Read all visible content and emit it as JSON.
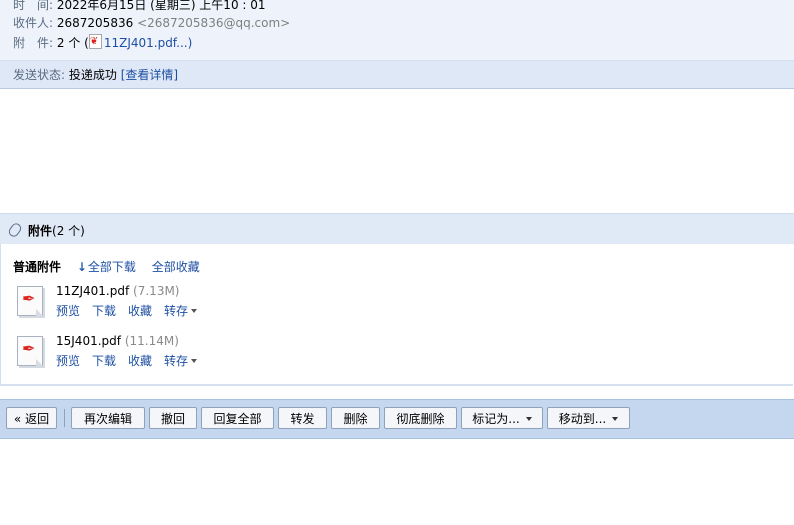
{
  "header": {
    "time": {
      "label": "时　间:",
      "value": "2022年6月15日 (星期三) 上午10 : 01"
    },
    "recipient": {
      "label": "收件人:",
      "name": "2687205836",
      "email": "<2687205836@qq.com>"
    },
    "attachments": {
      "label": "附　件:",
      "count": "2 个 (",
      "file_link": "11ZJ401.pdf...",
      "close_paren": ")"
    },
    "status": {
      "label": "发送状态:",
      "value": "投递成功",
      "details_link": "[查看详情]"
    }
  },
  "attachments_section": {
    "title": "附件",
    "count": "(2 个)",
    "category": "普通附件",
    "download_all": "全部下载",
    "save_all": "全部收藏",
    "files": [
      {
        "name": "11ZJ401.pdf",
        "size": "(7.13M)",
        "actions": [
          "预览",
          "下载",
          "收藏",
          "转存"
        ]
      },
      {
        "name": "15J401.pdf",
        "size": "(11.14M)",
        "actions": [
          "预览",
          "下载",
          "收藏",
          "转存"
        ]
      }
    ]
  },
  "toolbar": {
    "back": "« 返回",
    "reedit": "再次编辑",
    "recall": "撤回",
    "reply_all": "回复全部",
    "forward": "转发",
    "delete": "删除",
    "delete_permanent": "彻底删除",
    "mark_as": "标记为...",
    "move_to": "移动到..."
  },
  "icons": [
    "pdf-icon",
    "paperclip-icon",
    "download-icon",
    "chevron-down-icon"
  ],
  "colors": {
    "link": "#1e4fa3",
    "header_bg": "#eef3fb",
    "toolbar_bg": "#c4d7ef",
    "section_bg": "#e0e9f6"
  }
}
